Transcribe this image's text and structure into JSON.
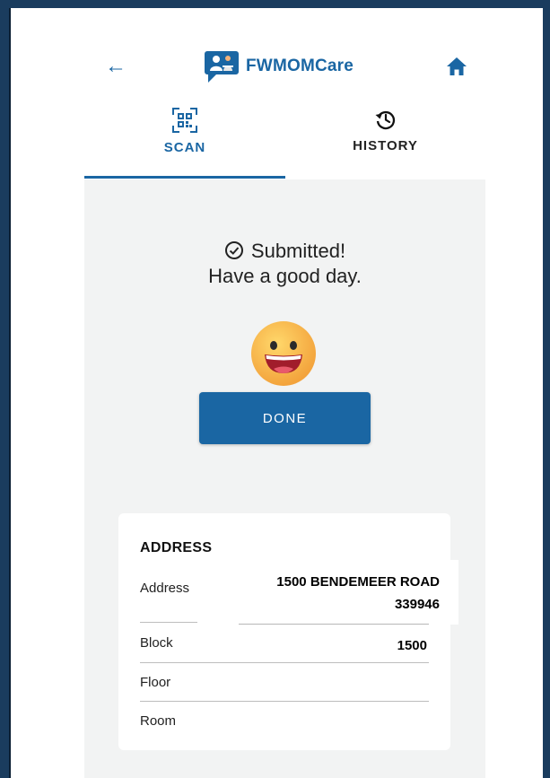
{
  "app": {
    "title": "FWMOMCare",
    "accent_color": "#1a66a3",
    "frame_color": "#1a3c5e"
  },
  "header": {
    "back_icon": "arrow-left-icon",
    "home_icon": "home-icon",
    "logo_icon": "chat-person-logo-icon"
  },
  "tabs": [
    {
      "label": "SCAN",
      "icon": "qr-code-icon",
      "active": true
    },
    {
      "label": "HISTORY",
      "icon": "history-icon",
      "active": false
    }
  ],
  "status": {
    "line1": "Submitted!",
    "line2": "Have a good day.",
    "icon": "check-circle-icon",
    "emoji": "laughing-face-icon"
  },
  "done_button": {
    "label": "DONE"
  },
  "address_card": {
    "title": "ADDRESS",
    "rows": [
      {
        "label": "Address",
        "value_line1": "1500 BENDEMEER ROAD",
        "value_line2": "339946"
      },
      {
        "label": "Block",
        "value": "1500"
      },
      {
        "label": "Floor",
        "value": ""
      },
      {
        "label": "Room",
        "value": ""
      }
    ]
  }
}
